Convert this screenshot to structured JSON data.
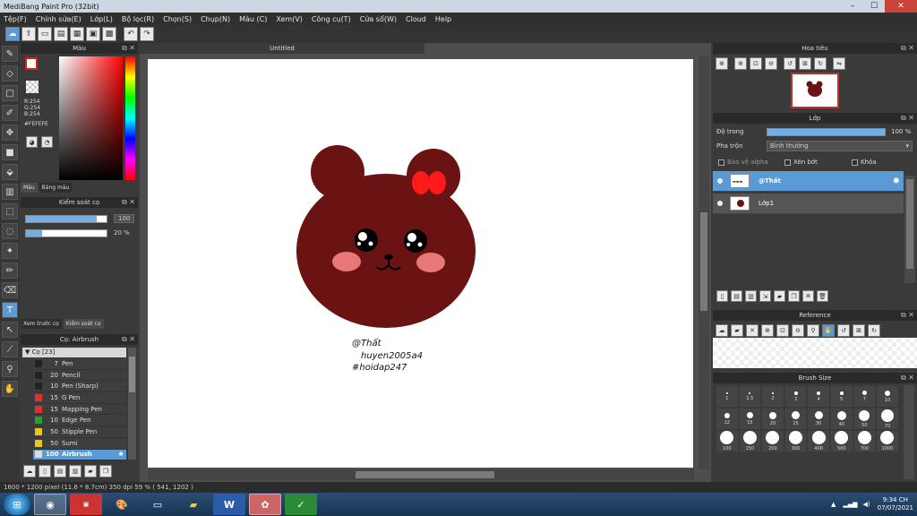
{
  "window": {
    "title": "MediBang Paint Pro (32bit)",
    "controls": [
      "–",
      "☐",
      "✕"
    ]
  },
  "menu": [
    "Tệp(F)",
    "Chỉnh sửa(E)",
    "Lớp(L)",
    "Bộ lọc(R)",
    "Chọn(S)",
    "Chụp(N)",
    "Màu (C)",
    "Xem(V)",
    "Công cụ(T)",
    "Cửa sổ(W)",
    "Cloud",
    "Help"
  ],
  "color_panel": {
    "title": "Màu",
    "rgb": "R:254\nG:254\nB:254",
    "hex": "#FEFEFE",
    "tabs": [
      "Màu",
      "Bảng màu"
    ],
    "fg_color": "#fefefe",
    "bg_color": "#d62020"
  },
  "brush_control": {
    "title": "Kiểm soát cọ",
    "size_value": "100",
    "size_fraction": 0.88,
    "opacity_value": "20 %",
    "opacity_fraction": 0.2,
    "tabs": [
      "Xem trước cọ",
      "Kiểm soát cọ"
    ]
  },
  "brush_list": {
    "title": "Cọ: Airbrush",
    "group": "Cọ [23]",
    "items": [
      {
        "size": "7",
        "name": "Pen",
        "color": "#222222"
      },
      {
        "size": "20",
        "name": "Pencil",
        "color": "#222222"
      },
      {
        "size": "10",
        "name": "Pen (Sharp)",
        "color": "#222222"
      },
      {
        "size": "15",
        "name": "G Pen",
        "color": "#e03030"
      },
      {
        "size": "15",
        "name": "Mapping Pen",
        "color": "#e03030"
      },
      {
        "size": "10",
        "name": "Edge Pen",
        "color": "#2aa02a"
      },
      {
        "size": "50",
        "name": "Stipple Pen",
        "color": "#e8c820"
      },
      {
        "size": "50",
        "name": "Sumi",
        "color": "#e8c820"
      },
      {
        "size": "100",
        "name": "Airbrush",
        "color": "#dddddd"
      }
    ],
    "selected": "Airbrush"
  },
  "canvas": {
    "tab": "Untitled",
    "text_line1": "@Thất",
    "text_line2": "huyen2005a4",
    "text_line3": "#hoidap247"
  },
  "navigator": {
    "title": "Hoa tiêu"
  },
  "layers": {
    "title": "Lớp",
    "opacity_label": "Độ trong",
    "opacity_value": "100 %",
    "blend_label": "Pha trộn",
    "blend_value": "Bình thường",
    "protect_alpha": "Bảo vệ alpha",
    "clipping": "Xén bớt",
    "lock": "Khóa",
    "items": [
      {
        "name": "@Thất",
        "selected": true
      },
      {
        "name": "Lớp1",
        "selected": false
      }
    ]
  },
  "reference": {
    "title": "Reference"
  },
  "brush_size": {
    "title": "Brush Size",
    "sizes": [
      "1",
      "1.5",
      "2",
      "3",
      "4",
      "5",
      "7",
      "10",
      "12",
      "15",
      "20",
      "25",
      "30",
      "40",
      "50",
      "70",
      "100",
      "150",
      "200",
      "300",
      "400",
      "500",
      "700",
      "1000"
    ]
  },
  "status": "1600 * 1200 pixel   (11.6 * 8.7cm)   350 dpi   59 %   ( 541, 1202 )",
  "taskbar": {
    "time": "9:34 CH",
    "date": "07/07/2021"
  },
  "colors": {
    "accent": "#5b9bd5",
    "bear": "#6b1212",
    "bow": "#ff1a1a",
    "cheek": "#e87878"
  }
}
